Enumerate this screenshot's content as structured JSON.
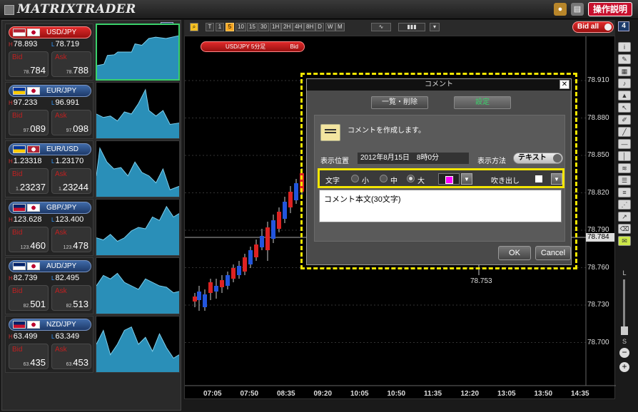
{
  "app": {
    "title": "MATRIXTRADER",
    "help_label": "操作説明"
  },
  "left": {
    "count": "6"
  },
  "pairs": [
    {
      "name": "USD/JPY",
      "high": "78.893",
      "low": "78.719",
      "bid_pre": "78.",
      "bid": "784",
      "ask_pre": "78.",
      "ask": "788",
      "active": true
    },
    {
      "name": "EUR/JPY",
      "high": "97.233",
      "low": "96.991",
      "bid_pre": "97.",
      "bid": "089",
      "ask_pre": "97.",
      "ask": "098",
      "active": false
    },
    {
      "name": "EUR/USD",
      "high": "1.23318",
      "low": "1.23170",
      "bid_pre": "1.",
      "bid": "23237",
      "ask_pre": "1.",
      "ask": "23244",
      "active": false
    },
    {
      "name": "GBP/JPY",
      "high": "123.628",
      "low": "123.400",
      "bid_pre": "123.",
      "bid": "460",
      "ask_pre": "123.",
      "ask": "478",
      "active": false
    },
    {
      "name": "AUD/JPY",
      "high": "82.739",
      "low": "82.495",
      "bid_pre": "82.",
      "bid": "501",
      "ask_pre": "82.",
      "ask": "513",
      "active": false
    },
    {
      "name": "NZD/JPY",
      "high": "63.499",
      "low": "63.349",
      "bid_pre": "63.",
      "bid": "435",
      "ask_pre": "63.",
      "ask": "453",
      "active": false
    }
  ],
  "labels": {
    "bid": "Bid",
    "ask": "Ask",
    "high": "H",
    "low": "L"
  },
  "toolbar": {
    "timeframes": [
      "T",
      "1",
      "5",
      "10",
      "15",
      "30",
      "1H",
      "2H",
      "4H",
      "8H",
      "D",
      "W",
      "M"
    ],
    "selected": "5",
    "bid_all": "Bid all",
    "right_count": "4"
  },
  "chart": {
    "tag": "USD/JPY 5分足",
    "tag_side": "Bid",
    "y_ticks": [
      "78.910",
      "78.880",
      "78.850",
      "78.820",
      "78.790",
      "78.760",
      "78.730",
      "78.700"
    ],
    "current_price": "78.784",
    "low_marker": "78.753",
    "x_ticks": [
      "07:05",
      "07:50",
      "08:35",
      "09:20",
      "10:05",
      "10:50",
      "11:35",
      "12:20",
      "13:05",
      "13:50",
      "14:35"
    ]
  },
  "dialog": {
    "title": "コメント",
    "close": "✕",
    "tab_list": "一覧・削除",
    "tab_settings": "設定",
    "message": "コメントを作成します。",
    "position_label": "表示位置",
    "position_value": "2012年8月15日　8時0分",
    "method_label": "表示方法",
    "method_value": "テキスト",
    "text_label": "文字",
    "size_small": "小",
    "size_medium": "中",
    "size_large": "大",
    "size_selected": "大",
    "text_color": "#ff00ff",
    "bubble_label": "吹き出し",
    "comment_text": "コメント本文(30文字)",
    "ok": "OK",
    "cancel": "Cancel"
  },
  "side": {
    "slider_top": "L",
    "slider_bottom": "S"
  }
}
